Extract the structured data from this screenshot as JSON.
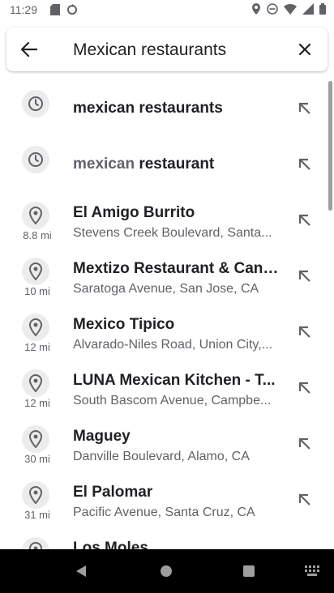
{
  "status_bar": {
    "time": "11:29"
  },
  "search": {
    "query": "Mexican restaurants"
  },
  "suggestions": [
    {
      "kind": "history",
      "title_main": "mexican restaurants",
      "title_muted": "",
      "distance": "",
      "subtitle": ""
    },
    {
      "kind": "history",
      "title_main": "restaurant",
      "title_muted": "mexican ",
      "distance": "",
      "subtitle": ""
    },
    {
      "kind": "place",
      "title_main": "El Amigo Burrito",
      "title_muted": "",
      "distance": "8.8 mi",
      "subtitle": "Stevens Creek Boulevard, Santa..."
    },
    {
      "kind": "place",
      "title_main": "Mextizo Restaurant & Cant...",
      "title_muted": "",
      "distance": "10 mi",
      "subtitle": "Saratoga Avenue, San Jose, CA"
    },
    {
      "kind": "place",
      "title_main": "Mexico Tipico",
      "title_muted": "",
      "distance": "12 mi",
      "subtitle": "Alvarado-Niles Road, Union City,..."
    },
    {
      "kind": "place",
      "title_main": "LUNA Mexican Kitchen - T...",
      "title_muted": "",
      "distance": "12 mi",
      "subtitle": "South Bascom Avenue, Campbe..."
    },
    {
      "kind": "place",
      "title_main": "Maguey",
      "title_muted": "",
      "distance": "30 mi",
      "subtitle": "Danville Boulevard, Alamo, CA"
    },
    {
      "kind": "place",
      "title_main": "El Palomar",
      "title_muted": "",
      "distance": "31 mi",
      "subtitle": "Pacific Avenue, Santa Cruz, CA"
    },
    {
      "kind": "place",
      "title_main": "Los Moles",
      "title_muted": "",
      "distance": "",
      "subtitle": ""
    }
  ],
  "colors": {
    "icon_gray": "#5f6368",
    "divider": "#e0e0e0",
    "nav_bg": "#000000"
  }
}
